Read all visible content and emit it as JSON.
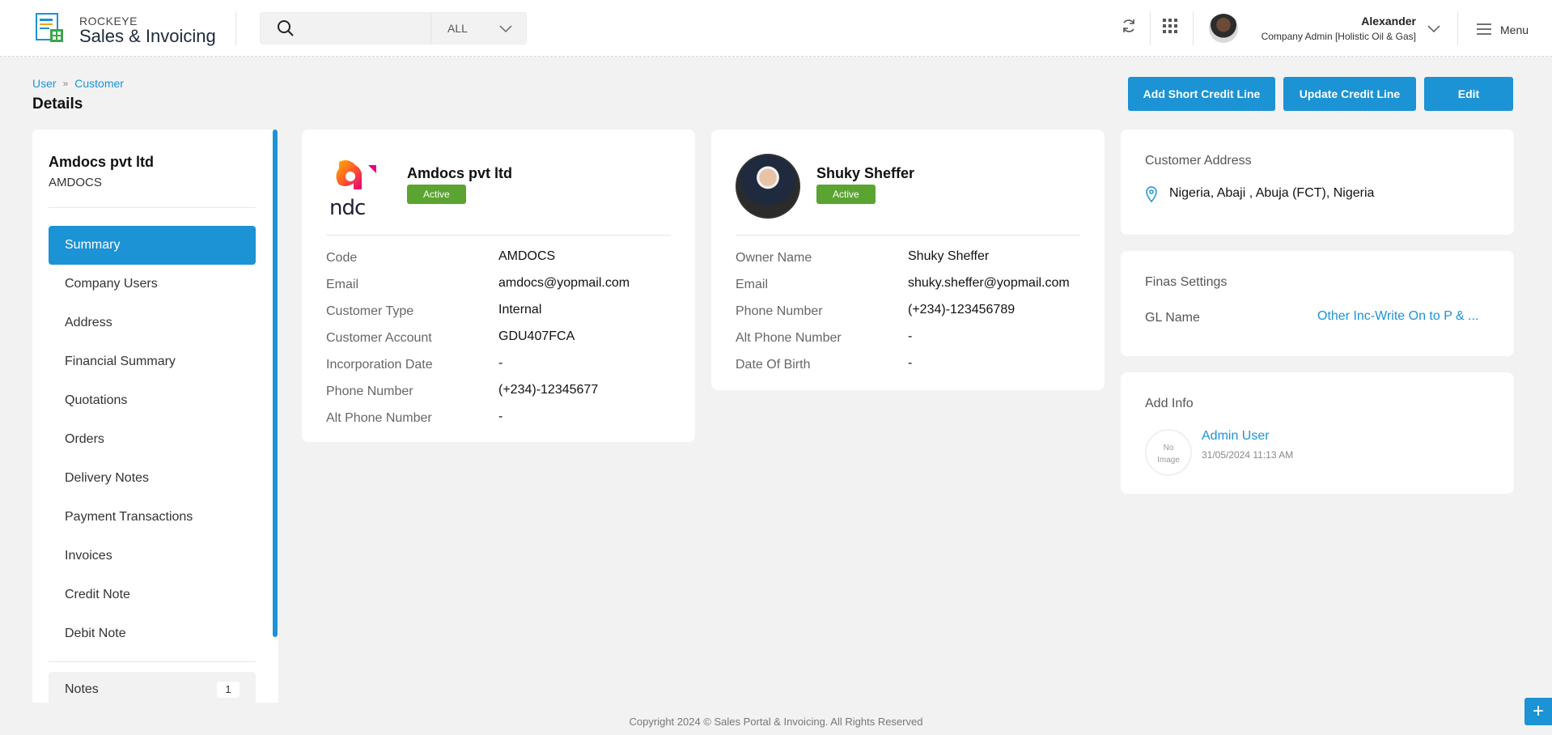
{
  "header": {
    "brand_top": "ROCKEYE",
    "brand_main": "Sales & Invoicing",
    "search_placeholder": "",
    "search_scope": "ALL",
    "user_name": "Alexander",
    "user_role": "Company Admin [Holistic Oil & Gas]",
    "menu_label": "Menu"
  },
  "breadcrumb": {
    "items": [
      "User",
      "Customer"
    ]
  },
  "page_title": "Details",
  "actions": {
    "add_short_credit": "Add Short Credit Line",
    "update_credit": "Update Credit Line",
    "edit": "Edit"
  },
  "sidebar": {
    "customer_name": "Amdocs pvt ltd",
    "customer_code": "AMDOCS",
    "items": [
      {
        "label": "Summary"
      },
      {
        "label": "Company Users"
      },
      {
        "label": "Address"
      },
      {
        "label": "Financial Summary"
      },
      {
        "label": "Quotations"
      },
      {
        "label": "Orders"
      },
      {
        "label": "Delivery Notes"
      },
      {
        "label": "Payment Transactions"
      },
      {
        "label": "Invoices"
      },
      {
        "label": "Credit Note"
      },
      {
        "label": "Debit Note"
      }
    ],
    "notes_label": "Notes",
    "notes_count": "1"
  },
  "company_card": {
    "name": "Amdocs pvt ltd",
    "status": "Active",
    "logo_text": "ndc",
    "fields": [
      {
        "key": "Code",
        "value": "AMDOCS"
      },
      {
        "key": "Email",
        "value": "amdocs@yopmail.com"
      },
      {
        "key": "Customer Type",
        "value": "Internal"
      },
      {
        "key": "Customer Account",
        "value": "GDU407FCA"
      },
      {
        "key": "Incorporation Date",
        "value": "-"
      },
      {
        "key": "Phone Number",
        "value": "(+234)-12345677"
      },
      {
        "key": "Alt Phone Number",
        "value": "-"
      }
    ]
  },
  "owner_card": {
    "name": "Shuky Sheffer",
    "status": "Active",
    "fields": [
      {
        "key": "Owner Name",
        "value": "Shuky Sheffer"
      },
      {
        "key": "Email",
        "value": "shuky.sheffer@yopmail.com"
      },
      {
        "key": "Phone Number",
        "value": "(+234)-123456789"
      },
      {
        "key": "Alt Phone Number",
        "value": "-"
      },
      {
        "key": "Date Of Birth",
        "value": "-"
      }
    ]
  },
  "address_card": {
    "title": "Customer Address",
    "address": "Nigeria, Abaji , Abuja (FCT), Nigeria"
  },
  "finas_card": {
    "title": "Finas Settings",
    "gl_label": "GL Name",
    "gl_value": "Other Inc-Write On to P & ..."
  },
  "add_info_card": {
    "title": "Add Info",
    "no_image_line1": "No",
    "no_image_line2": "Image",
    "user": "Admin User",
    "timestamp": "31/05/2024 11:13 AM"
  },
  "footer": "Copyright 2024 © Sales Portal & Invoicing. All Rights Reserved",
  "colors": {
    "accent": "#1b93d4",
    "status_active": "#5ba431"
  }
}
